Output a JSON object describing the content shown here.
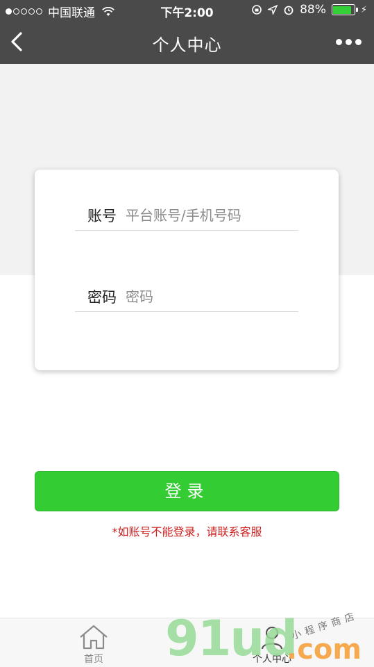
{
  "status_bar": {
    "carrier": "中国联通",
    "time": "下午2:00",
    "battery_percent": "88%",
    "battery_level": 0.88,
    "signal_bars_filled": 1,
    "signal_bars_total": 5
  },
  "nav": {
    "title": "个人中心"
  },
  "login": {
    "account_label": "账号",
    "account_placeholder": "平台账号/手机号码",
    "password_label": "密码",
    "password_placeholder": "密码",
    "button_label": "登录",
    "notice": "*如账号不能登录，请联系客服"
  },
  "tabs": [
    {
      "label": "首页",
      "icon": "home-icon"
    },
    {
      "label": "个人中心",
      "icon": "user-icon"
    }
  ],
  "watermark": {
    "brand": "91ud",
    "suffix": ".com",
    "tagline": "小程序商店"
  },
  "colors": {
    "nav_bg": "#4a4a4a",
    "accent_green": "#33cc33",
    "notice_red": "#cc1f1f"
  }
}
